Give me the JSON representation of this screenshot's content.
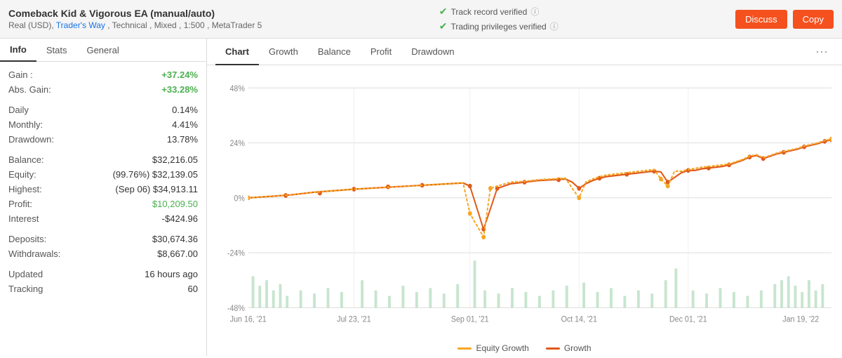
{
  "header": {
    "title": "Comeback Kid & Vigorous EA (manual/auto)",
    "subtitle_parts": [
      "Real (USD)",
      "Trader's Way",
      "Technical",
      "Mixed",
      "1:500",
      "MetaTrader 5"
    ],
    "traders_way_label": "Trader's Way",
    "verify1": "Track record verified",
    "verify2": "Trading privileges verified",
    "btn_discuss": "Discuss",
    "btn_copy": "Copy"
  },
  "tabs": {
    "items": [
      "Info",
      "Stats",
      "General"
    ],
    "active": "Info"
  },
  "stats": {
    "gain_label": "Gain :",
    "gain_value": "+37.24%",
    "abs_gain_label": "Abs. Gain:",
    "abs_gain_value": "+33.28%",
    "daily_label": "Daily",
    "daily_value": "0.14%",
    "monthly_label": "Monthly:",
    "monthly_value": "4.41%",
    "drawdown_label": "Drawdown:",
    "drawdown_value": "13.78%",
    "balance_label": "Balance:",
    "balance_value": "$32,216.05",
    "equity_label": "Equity:",
    "equity_value": "(99.76%) $32,139.05",
    "highest_label": "Highest:",
    "highest_value": "(Sep 06) $34,913.11",
    "profit_label": "Profit:",
    "profit_value": "$10,209.50",
    "interest_label": "Interest",
    "interest_value": "-$424.96",
    "deposits_label": "Deposits:",
    "deposits_value": "$30,674.36",
    "withdrawals_label": "Withdrawals:",
    "withdrawals_value": "$8,667.00",
    "updated_label": "Updated",
    "updated_value": "16 hours ago",
    "tracking_label": "Tracking",
    "tracking_value": "60"
  },
  "chart_tabs": {
    "items": [
      "Chart",
      "Growth",
      "Balance",
      "Profit",
      "Drawdown"
    ],
    "active": "Chart"
  },
  "chart": {
    "y_labels": [
      "48%",
      "24%",
      "0%",
      "-24%",
      "-48%"
    ],
    "x_labels": [
      "Jun 16, '21",
      "Jul 23, '21",
      "Sep 01, '21",
      "Oct 14, '21",
      "Dec 01, '21",
      "Jan 19, '22"
    ],
    "legend_equity": "Equity Growth",
    "legend_growth": "Growth"
  },
  "more_icon": "···"
}
